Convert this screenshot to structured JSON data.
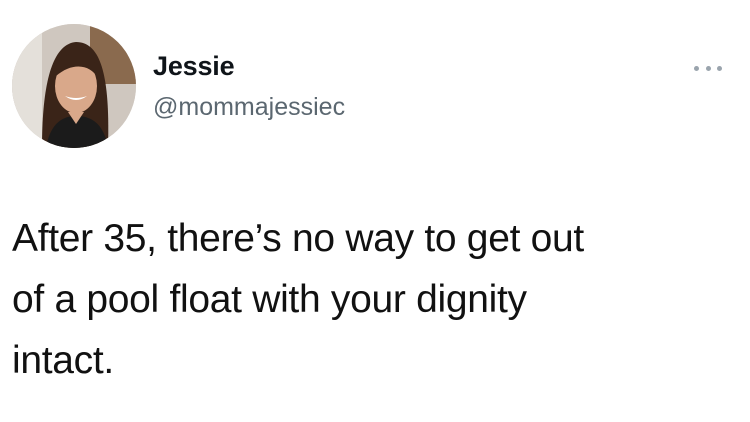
{
  "tweet": {
    "author": {
      "name": "Jessie",
      "handle": "@mommajessiec",
      "avatar_icon": "profile-photo"
    },
    "more_icon": "ellipsis-icon",
    "text_lines": [
      "After 35, there’s no way to get out",
      "of a pool float with your dignity",
      "intact."
    ]
  },
  "colors": {
    "background": "#ffffff",
    "name": "#0f1419",
    "handle": "#5b6770",
    "body_text": "#111111",
    "more_dots": "#9aa4ad"
  }
}
